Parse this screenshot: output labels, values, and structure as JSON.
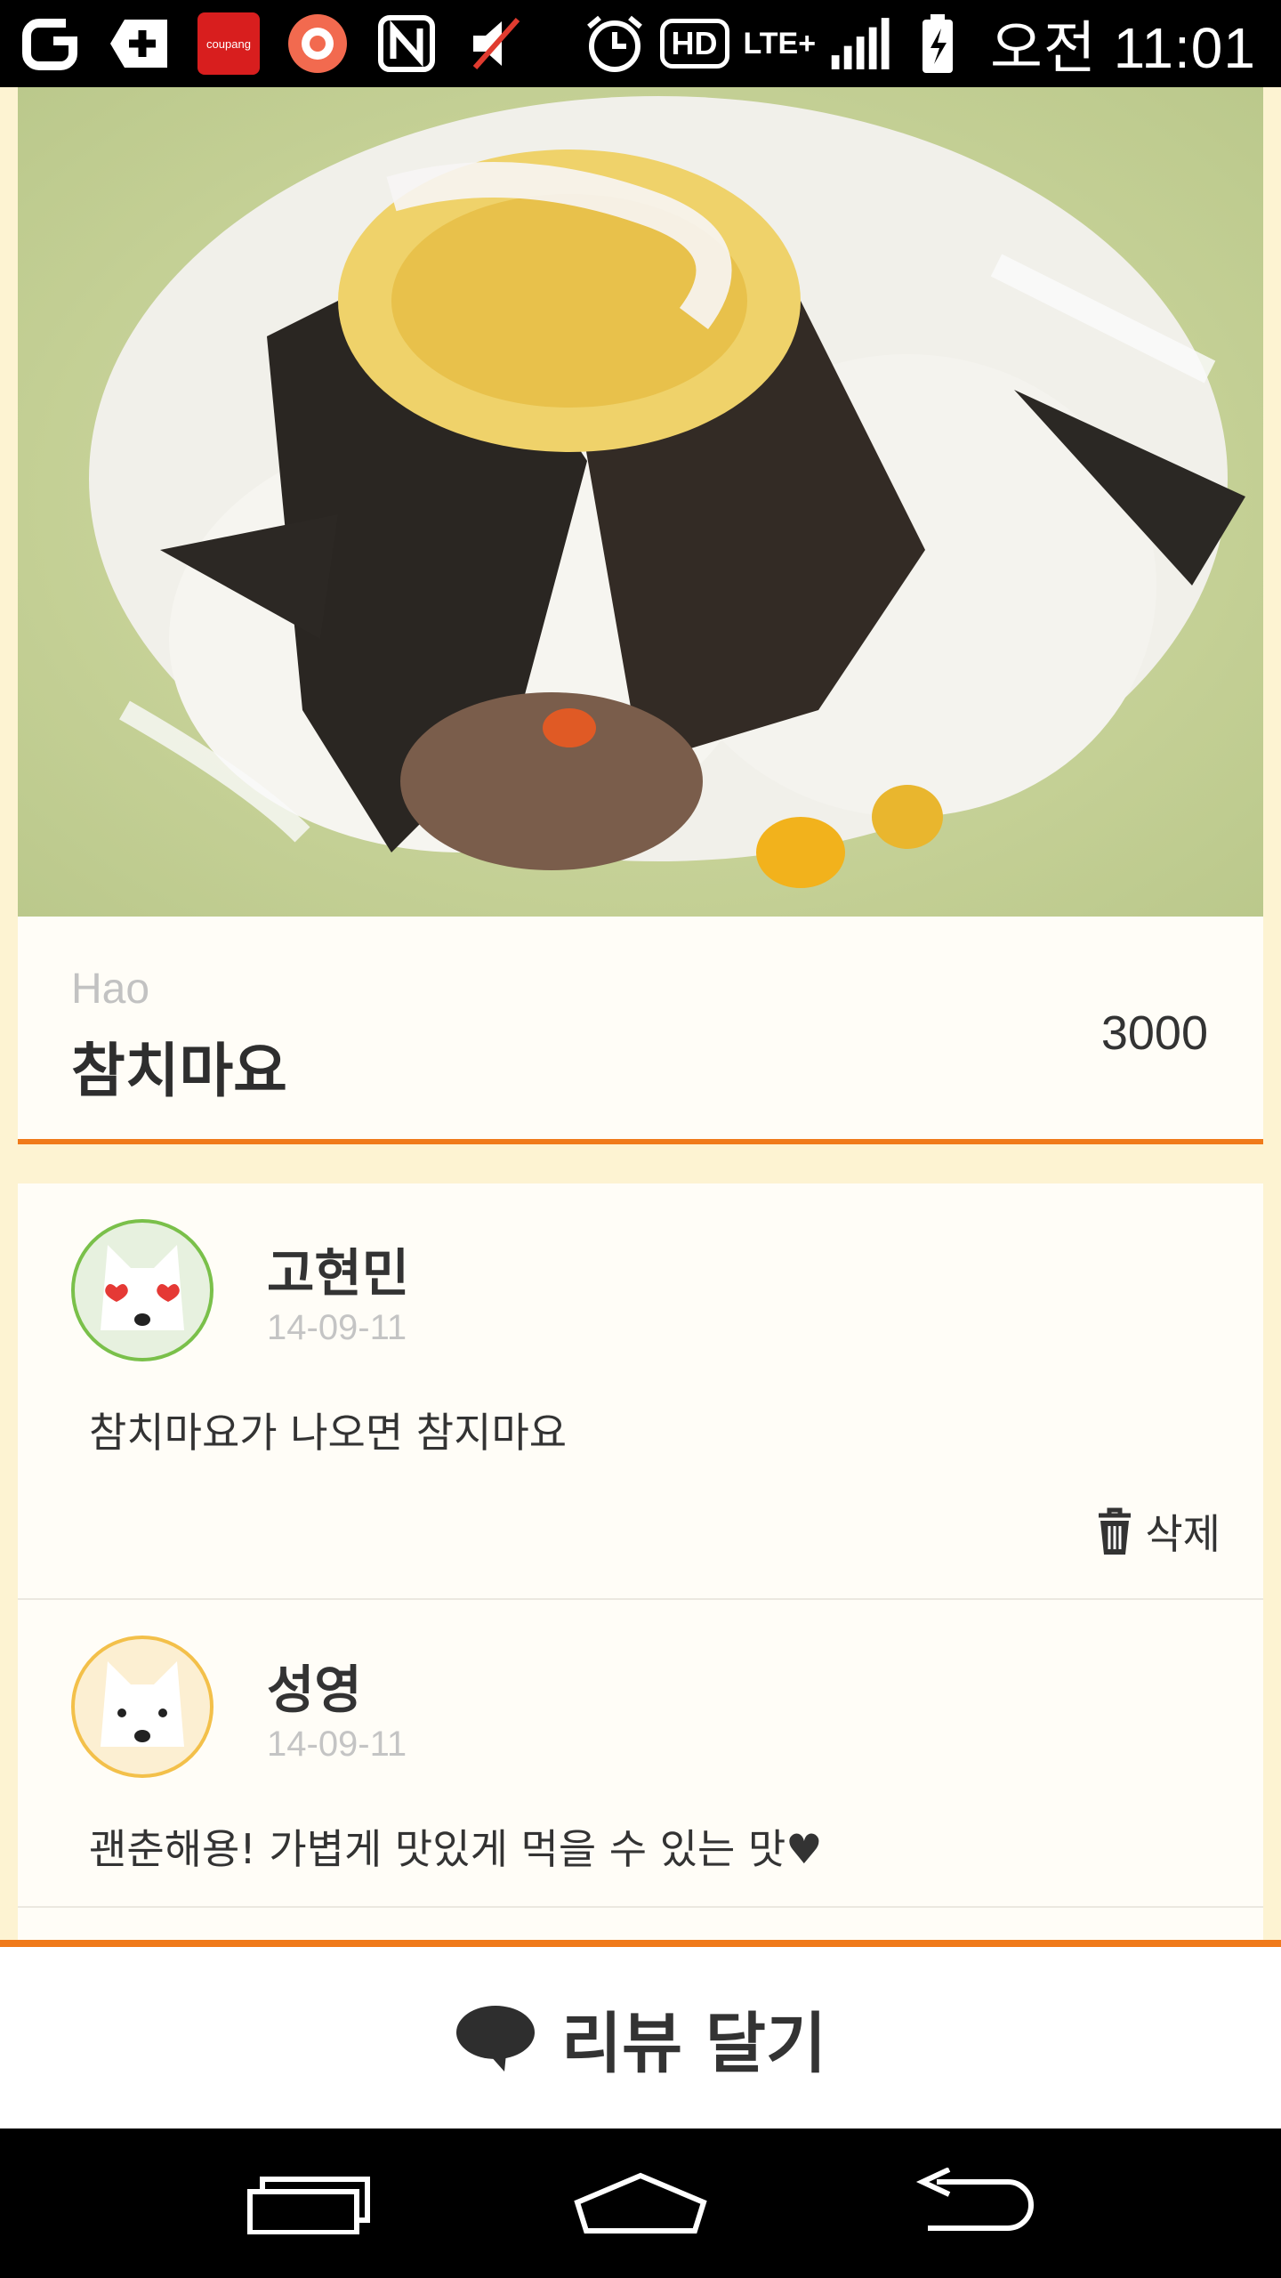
{
  "status_bar": {
    "time": "오전 11:01",
    "network": "LTE+",
    "hd_label": "HD",
    "coupang_label": "coupang",
    "icons": [
      "g-icon",
      "plus-shield-icon",
      "coupang-icon",
      "record-icon",
      "nfc-icon",
      "mute-icon",
      "alarm-icon",
      "hd-icon",
      "lte-icon",
      "signal-icon",
      "battery-icon"
    ]
  },
  "menu": {
    "store": "Hao",
    "name": "참치마요",
    "price": "3000"
  },
  "reviews": [
    {
      "name": "고현민",
      "date": "14-09-11",
      "text": "참치마요가 나오면 참지마요",
      "delete_label": "삭제",
      "avatar": "dog-hearts-avatar",
      "avatar_color": "#7ac04a"
    },
    {
      "name": "성영",
      "date": "14-09-11",
      "text": "괜춘해용! 가볍게 맛있게 먹을 수 있는 맛♥",
      "avatar": "dog-avatar",
      "avatar_color": "#f3c04a"
    }
  ],
  "write_review": {
    "label": "리뷰 달기"
  },
  "colors": {
    "accent": "#f07a1a",
    "background": "#fdf3d2",
    "card": "#fffdf7"
  },
  "nav": [
    "recent-apps-icon",
    "home-icon",
    "back-icon"
  ]
}
